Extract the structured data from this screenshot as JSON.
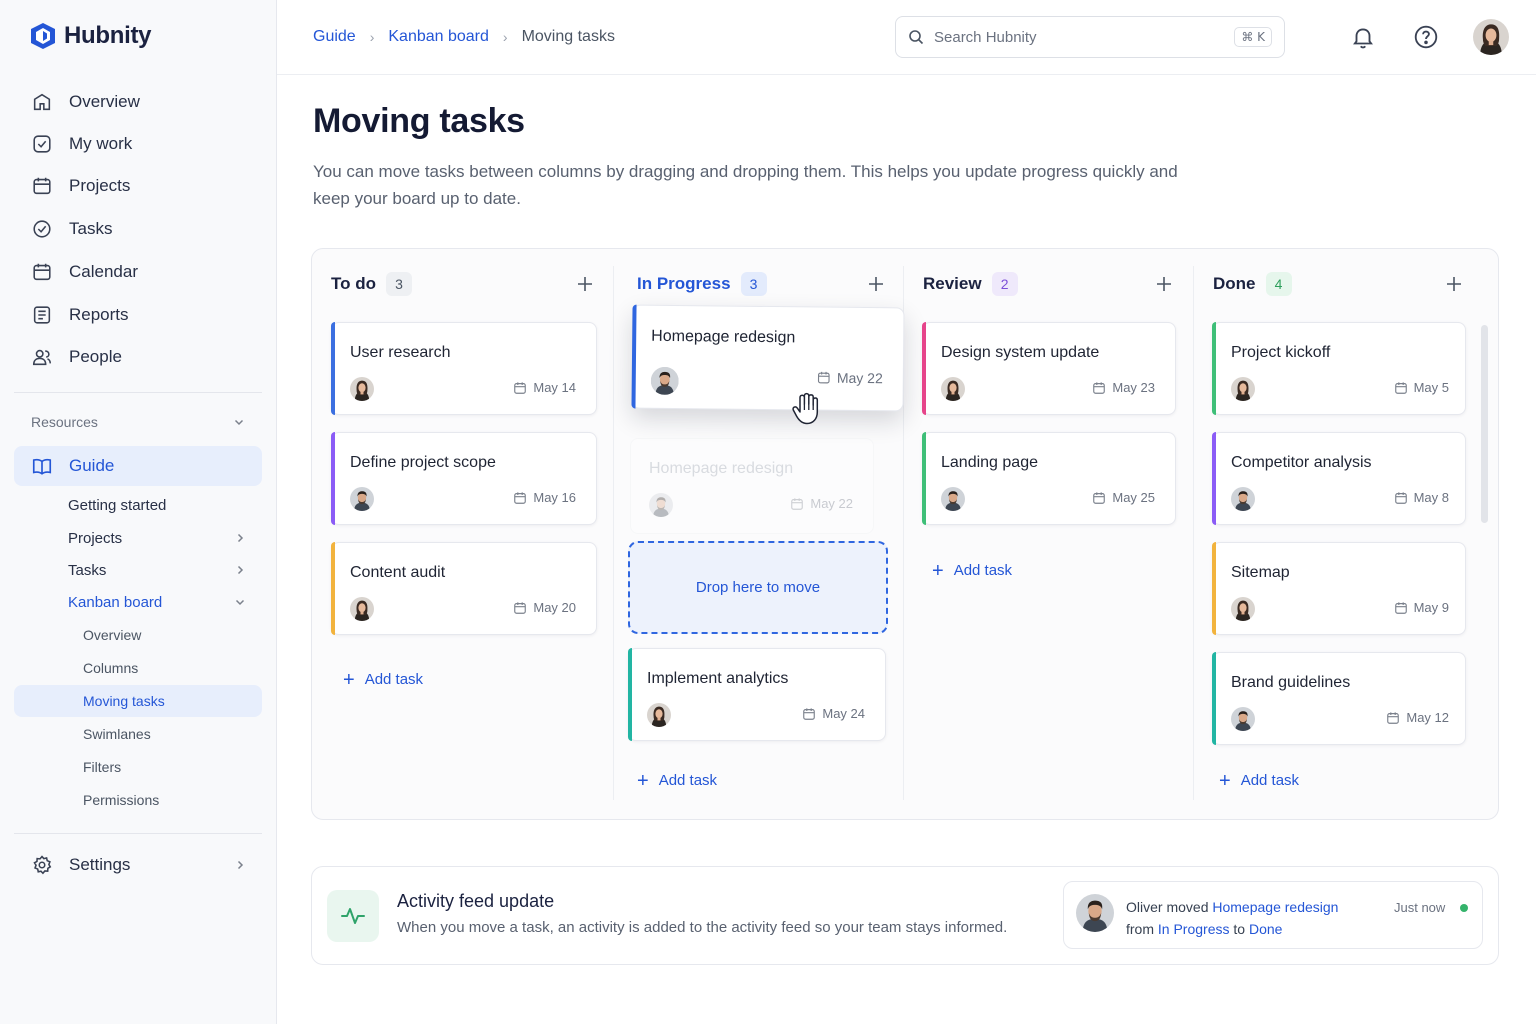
{
  "app": {
    "name": "Hubnity"
  },
  "sidebar": {
    "nav": [
      {
        "label": "Overview",
        "icon": "home-icon"
      },
      {
        "label": "My work",
        "icon": "check-square-icon"
      },
      {
        "label": "Projects",
        "icon": "folder-icon"
      },
      {
        "label": "Tasks",
        "icon": "check-circle-icon"
      },
      {
        "label": "Calendar",
        "icon": "calendar-icon"
      },
      {
        "label": "Reports",
        "icon": "report-icon"
      },
      {
        "label": "People",
        "icon": "people-icon"
      }
    ],
    "resources_label": "Resources",
    "guide_label": "Guide",
    "guide_items": [
      {
        "label": "Getting started"
      },
      {
        "label": "Projects"
      },
      {
        "label": "Tasks"
      },
      {
        "label": "Kanban board"
      }
    ],
    "kanban_items": [
      {
        "label": "Overview"
      },
      {
        "label": "Columns"
      },
      {
        "label": "Moving tasks"
      },
      {
        "label": "Swimlanes"
      },
      {
        "label": "Filters"
      },
      {
        "label": "Permissions"
      }
    ],
    "settings_label": "Settings"
  },
  "breadcrumb": {
    "items": [
      "Guide",
      "Kanban board"
    ],
    "current": "Moving tasks"
  },
  "search": {
    "placeholder": "Search Hubnity",
    "shortcut": "⌘ K"
  },
  "page": {
    "title": "Moving tasks",
    "description": "You can move tasks between columns by dragging and dropping them. This helps you update progress quickly and keep your board up to date."
  },
  "board": {
    "add_task_label": "Add task",
    "drop_label": "Drop here to move",
    "columns": [
      {
        "name": "To do",
        "count": "3",
        "cards": [
          {
            "title": "User research",
            "date": "May 14",
            "avatar": "woman"
          },
          {
            "title": "Define project scope",
            "date": "May 16",
            "avatar": "man"
          },
          {
            "title": "Content audit",
            "date": "May 20",
            "avatar": "woman"
          }
        ]
      },
      {
        "name": "In Progress",
        "count": "3",
        "dragging": {
          "title": "Homepage redesign",
          "date": "May 22"
        },
        "ghost": {
          "title": "Homepage redesign",
          "date": "May 22"
        },
        "cards": [
          {
            "title": "Implement analytics",
            "date": "May 24",
            "avatar": "woman"
          }
        ]
      },
      {
        "name": "Review",
        "count": "2",
        "cards": [
          {
            "title": "Design system update",
            "date": "May 23",
            "avatar": "woman"
          },
          {
            "title": "Landing page",
            "date": "May 25",
            "avatar": "man"
          }
        ]
      },
      {
        "name": "Done",
        "count": "4",
        "cards": [
          {
            "title": "Project kickoff",
            "date": "May 5",
            "avatar": "woman"
          },
          {
            "title": "Competitor analysis",
            "date": "May 8",
            "avatar": "man"
          },
          {
            "title": "Sitemap",
            "date": "May 9",
            "avatar": "woman"
          },
          {
            "title": "Brand guidelines",
            "date": "May 12",
            "avatar": "man"
          }
        ]
      }
    ]
  },
  "activity": {
    "title": "Activity feed update",
    "description": "When you move a task, an activity is added to the activity feed so your team stays informed.",
    "feed": {
      "user": "Oliver",
      "verb": "moved",
      "task": "Homepage redesign",
      "from_word": "from",
      "from": "In Progress",
      "to_word": "to",
      "to": "Done",
      "time": "Just now"
    }
  },
  "colors": {
    "accent": "#2456d6",
    "todo": "#3b6fe0",
    "progress": "#2f66e0",
    "review": "#e6448a",
    "done": "#3fbf78",
    "teal": "#22b5a3",
    "purple": "#8b5cf6",
    "yellow": "#f2b33d",
    "online": "#34b36b"
  }
}
